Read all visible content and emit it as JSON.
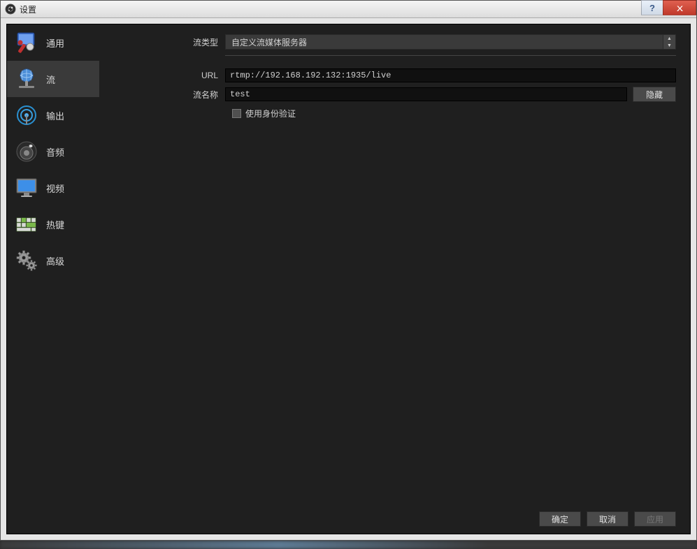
{
  "window": {
    "title": "设置"
  },
  "sidebar": {
    "items": [
      {
        "label": "通用"
      },
      {
        "label": "流"
      },
      {
        "label": "输出"
      },
      {
        "label": "音频"
      },
      {
        "label": "视频"
      },
      {
        "label": "热键"
      },
      {
        "label": "高级"
      }
    ]
  },
  "form": {
    "stream_type_label": "流类型",
    "stream_type_value": "自定义流媒体服务器",
    "url_label": "URL",
    "url_value": "rtmp://192.168.192.132:1935/live",
    "stream_name_label": "流名称",
    "stream_name_value": "test",
    "hide_button": "隐藏",
    "use_auth_label": "使用身份验证"
  },
  "footer": {
    "ok": "确定",
    "cancel": "取消",
    "apply": "应用"
  }
}
